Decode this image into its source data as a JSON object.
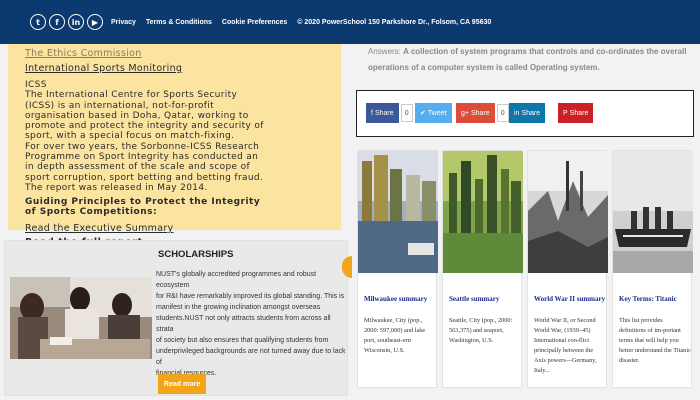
{
  "topbar": {
    "social_icons": [
      {
        "icon": "twitter-icon",
        "glyph": "t"
      },
      {
        "icon": "facebook-icon",
        "glyph": "f"
      },
      {
        "icon": "linkedin-icon",
        "glyph": "in"
      },
      {
        "icon": "youtube-icon",
        "glyph": "▶"
      }
    ],
    "links": [
      "Privacy",
      "Terms & Conditions",
      "Cookie Preferences",
      "© 2020 PowerSchool 150 Parkshore Dr., Folsom, CA 95630"
    ],
    "bg_color": "#0d3a6e"
  },
  "yellow_panel": {
    "link_faded": "The Ethics Commission",
    "link_monitoring": "International Sports Monitoring",
    "body_lines": [
      "ICSS",
      "The International Centre for Sports Security",
      "(ICSS) is an international, not-for-profit",
      "organisation based in Doha, Qatar, working to",
      "promote and protect the integrity and security of",
      "sport, with a special focus on match-fixing.",
      "For over two years, the Sorbonne-ICSS Research",
      "Programme on Sport Integrity has conducted an",
      "in depth assessment of the scale and scope of",
      "sport corruption, sport betting and betting fraud.",
      "The report was released in May 2014."
    ],
    "heading_lines": [
      "Guiding Principles to Protect the Integrity",
      "of Sports Competitions:"
    ],
    "link_summary": "Read the Executive Summary",
    "link_full": "Read the full report",
    "bg_color": "#fbe3a0"
  },
  "scholarships": {
    "title": "SCHOLARSHIPS",
    "text_lines": [
      "NUST's globally accredited programmes and robust ecosystem",
      "for R&I have remarkably improved its global standing. This is",
      "manifest in the growing inclination amongst overseas",
      "students.NUST not only attracts students from across all strata",
      "of society but also ensures that qualifying students from",
      "underprivileged backgrounds are not turned away due to lack of",
      "financial resources."
    ],
    "button": "Read more",
    "accent": "#f2a51a"
  },
  "answer": {
    "label": "Answers:",
    "text": "A collection of system programs that controls and co-ordinates the overall operations of a computer system is called Operating system."
  },
  "share_bar": [
    {
      "label": "Share",
      "count": "0",
      "icon": "facebook-icon",
      "color": "#3b5998"
    },
    {
      "label": "Tweet",
      "count": "",
      "icon": "twitter-icon",
      "color": "#55acee"
    },
    {
      "label": "Share",
      "count": "0",
      "icon": "google-plus-icon",
      "color": "#dd4b39"
    },
    {
      "label": "Share",
      "count": "",
      "icon": "linkedin-icon",
      "color": "#0e76a8"
    },
    {
      "label": "Share",
      "count": "",
      "icon": "pinterest-icon",
      "color": "#cb2027"
    }
  ],
  "cards": [
    {
      "title": "Milwaukee summary",
      "text": "Milwaukee, City (pop., 2000: 597,000) and lake port, southeast-ern Wisconsin, U.S."
    },
    {
      "title": "Seattle summary",
      "text": "Seattle, City (pop., 2000: 563,375) and seaport, Washington, U.S."
    },
    {
      "title": "World War II summary",
      "text": "World War II, or Second World War, (1939–45) International con-flict principally between the Axis powers—Germany, Italy..."
    },
    {
      "title": "Key Terms: Titanic",
      "text": "This list provides definitions of im-portant terms that will help you better understand the Titanic disaster."
    }
  ]
}
